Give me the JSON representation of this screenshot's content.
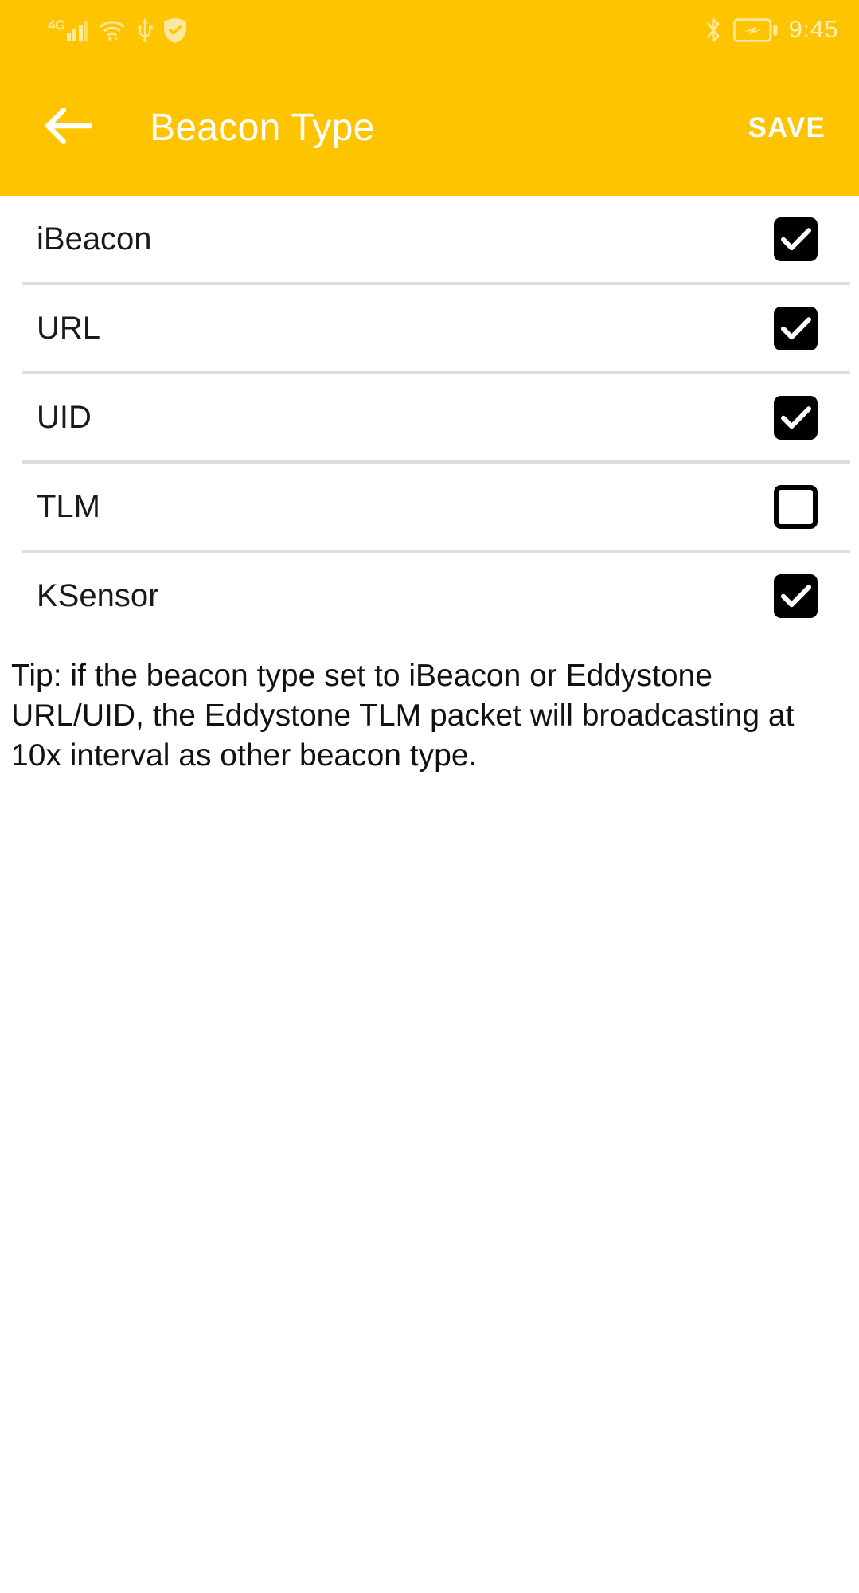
{
  "theme": {
    "brand_color": "#ffc400",
    "accent_text": "#ffffff",
    "divider_color": "#dedede"
  },
  "status_bar": {
    "network_label": "4G",
    "time": "9:45",
    "icons_left": [
      "signal-bars-icon",
      "wifi-icon",
      "usb-icon",
      "shield-check-icon"
    ],
    "icons_right": [
      "bluetooth-icon",
      "battery-charging-icon"
    ]
  },
  "app_bar": {
    "back_icon": "arrow-left-icon",
    "title": "Beacon Type",
    "save_label": "SAVE"
  },
  "list": {
    "items": [
      {
        "label": "iBeacon",
        "checked": true
      },
      {
        "label": "URL",
        "checked": true
      },
      {
        "label": "UID",
        "checked": true
      },
      {
        "label": "TLM",
        "checked": false
      },
      {
        "label": "KSensor",
        "checked": true
      }
    ]
  },
  "tip": {
    "text": "Tip: if the beacon type set to iBeacon or Eddystone URL/UID, the Eddystone TLM packet will broadcasting at 10x interval as other beacon type."
  }
}
